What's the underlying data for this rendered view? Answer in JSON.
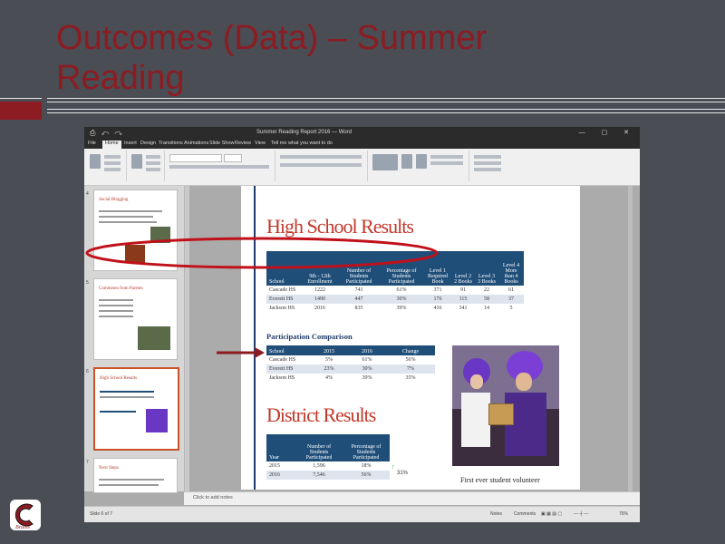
{
  "slide": {
    "title": "Outcomes (Data) – Summer Reading"
  },
  "colors": {
    "accent": "#8d1b22",
    "background": "#4a4d53",
    "table_header": "#1f4e79",
    "heading_red": "#c0392b"
  },
  "window": {
    "title": "Summer Reading Report 2016 — Word",
    "tabs": [
      "File",
      "Home",
      "Insert",
      "Design",
      "Transitions",
      "Animations",
      "Slide Show",
      "Review",
      "View",
      "Tell me what you want to do"
    ]
  },
  "document": {
    "hs_heading": "High School Results",
    "hs_table": {
      "headers": [
        "School",
        "9th - 12th Enrollment",
        "Number of Students Participated",
        "Percentage of Students Participated",
        "Level 1 Required Book",
        "Level 2 2 Books",
        "Level 3 3 Books",
        "Level 4 More than 4 Books"
      ],
      "rows": [
        [
          "Cascade HS",
          "1222",
          "741",
          "61%",
          "371",
          "91",
          "22",
          "61"
        ],
        [
          "Everett HS",
          "1490",
          "447",
          "30%",
          "176",
          "115",
          "58",
          "37"
        ],
        [
          "Jackson HS",
          "2016",
          "835",
          "39%",
          "416",
          "341",
          "14",
          "5"
        ]
      ]
    },
    "participation_heading": "Participation Comparison",
    "participation_table": {
      "headers": [
        "School",
        "2015",
        "2016",
        "Change"
      ],
      "rows": [
        [
          "Cascade HS",
          "5%",
          "61%",
          "56%"
        ],
        [
          "Everett HS",
          "23%",
          "30%",
          "7%"
        ],
        [
          "Jackson HS",
          "4%",
          "39%",
          "35%"
        ]
      ]
    },
    "district_heading": "District Results",
    "district_table": {
      "headers": [
        "Year",
        "Number of Students Participated",
        "Percentage of Students Participated"
      ],
      "rows": [
        [
          "2015",
          "1,596",
          "18%"
        ],
        [
          "2016",
          "7,546",
          "56%"
        ]
      ]
    },
    "side_note": "31%",
    "photo_caption": "First ever student volunteer"
  },
  "thumbnails": [
    {
      "number": "4",
      "title": "Social Blogging"
    },
    {
      "number": "5",
      "title": "Comments from Parents"
    },
    {
      "number": "6",
      "title": "High School Results"
    },
    {
      "number": "7",
      "title": "Next Steps"
    }
  ],
  "notes_placeholder": "Click to add notes",
  "status": {
    "left": "Slide 6 of 7",
    "notes": "Notes",
    "comments": "Comments",
    "zoom": "76%"
  }
}
